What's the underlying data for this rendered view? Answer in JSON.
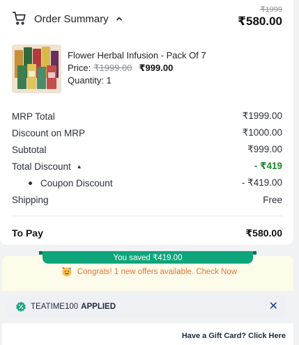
{
  "header": {
    "title": "Order Summary",
    "mrp_total": "₹1999",
    "to_pay": "₹580.00",
    "icons": [
      "cart-icon",
      "caret-up-icon"
    ]
  },
  "product": {
    "name": "Flower Herbal Infusion - Pack Of 7",
    "price_label": "Price:",
    "price_mrp": "₹1999.00",
    "price_now": "₹999.00",
    "quantity": "Quantity: 1"
  },
  "breakdown": {
    "mrp_total": {
      "label": "MRP Total",
      "value": "₹1999.00"
    },
    "discount_mrp": {
      "label": "Discount on MRP",
      "value": "₹1000.00"
    },
    "subtotal": {
      "label": "Subtotal",
      "value": "₹999.00"
    },
    "total_discount": {
      "label": "Total Discount",
      "toggle": "▲",
      "value": "- ₹419"
    },
    "coupon_discount": {
      "label": "Coupon Discount",
      "value": "- ₹419.00"
    },
    "shipping": {
      "label": "Shipping",
      "value": "Free"
    },
    "to_pay": {
      "label": "To Pay",
      "value": "₹580.00"
    }
  },
  "savings": {
    "ribbon": "You saved ₹419.00",
    "congrats": "Congrats! 1 new offers available. Check Now"
  },
  "coupon": {
    "code": "TEATIME100",
    "status": "APPLIED",
    "close": "✕"
  },
  "footer": {
    "gift_card_link": "Have a Gift Card? Click Here"
  },
  "colors": {
    "accent_green": "#0fa57a",
    "discount_green": "#1f8a2e",
    "congrats_orange": "#e0763a"
  }
}
